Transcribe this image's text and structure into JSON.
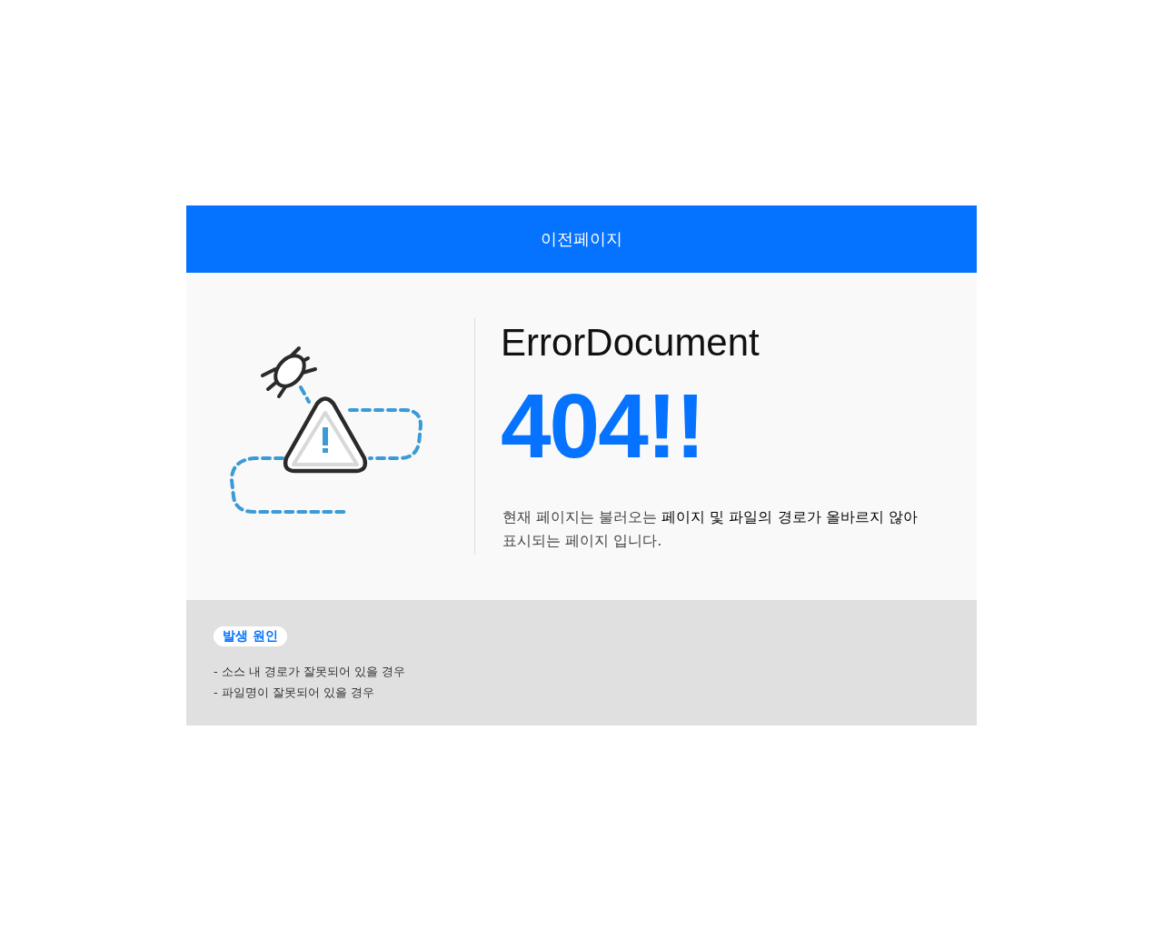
{
  "header": {
    "back_link": "이전페이지"
  },
  "error": {
    "title": "ErrorDocument",
    "code": "404!!",
    "description_lines": [
      "현재 페이지는 불러오는 **페이지 및 파일의 경로가 올바르지 않아**",
      "표시되는 페이지 입니다."
    ]
  },
  "causes": {
    "badge": "발생 원인",
    "items": [
      "- 소스 내 경로가 잘못되어 있을 경우",
      "- 파일명이 잘못되어 있을 경우"
    ]
  }
}
